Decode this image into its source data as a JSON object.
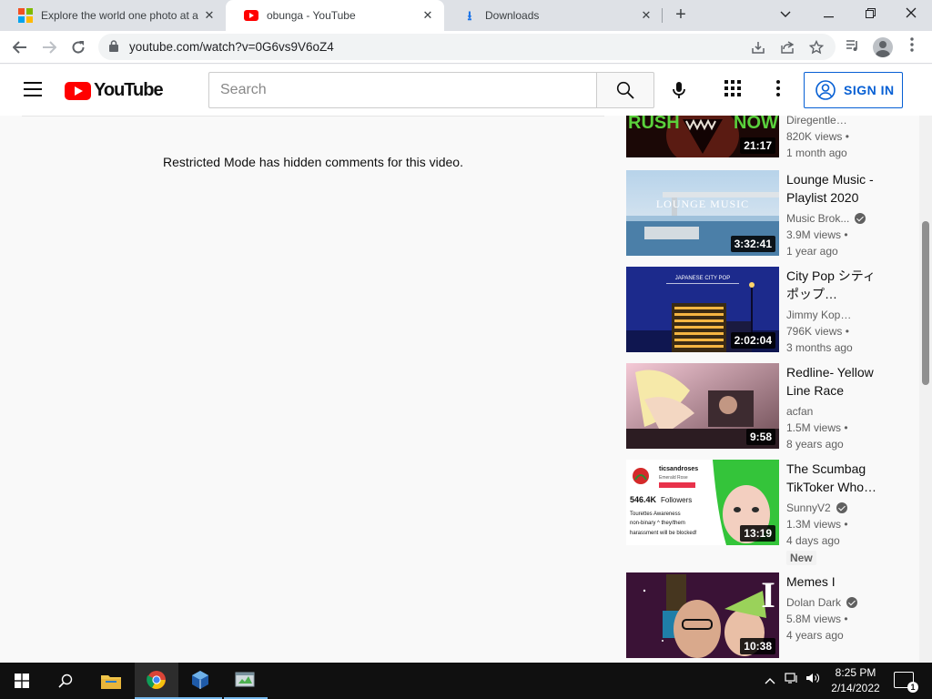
{
  "browser": {
    "tabs": [
      {
        "title": "Explore the world one photo at a",
        "favicon": "microsoft-icon",
        "active": false
      },
      {
        "title": "obunga - YouTube",
        "favicon": "youtube-icon",
        "active": true
      },
      {
        "title": "Downloads",
        "favicon": "download-icon",
        "active": false
      }
    ],
    "new_tab": "+",
    "url": "youtube.com/watch?v=0G6vs9V6oZ4"
  },
  "youtube": {
    "logo_text": "YouTube",
    "search_placeholder": "Search",
    "signin_label": "SIGN IN",
    "restricted_message": "Restricted Mode has hidden comments for this video.",
    "recommendations": [
      {
        "title": "",
        "channel": "Diregentleman",
        "verified": false,
        "views": "820K views •",
        "age": "1 month ago",
        "duration": "21:17",
        "badge": ""
      },
      {
        "title": "Lounge Music - Playlist 2020",
        "channel": "Music Brok...",
        "verified": true,
        "views": "3.9M views •",
        "age": "1 year ago",
        "duration": "3:32:41",
        "badge": ""
      },
      {
        "title": "City Pop シティポップ…",
        "channel": "Jimmy Koproto",
        "verified": false,
        "views": "796K views •",
        "age": "3 months ago",
        "duration": "2:02:04",
        "badge": ""
      },
      {
        "title": "Redline- Yellow Line Race",
        "channel": "acfan",
        "verified": false,
        "views": "1.5M views •",
        "age": "8 years ago",
        "duration": "9:58",
        "badge": ""
      },
      {
        "title": "The Scumbag TikToker Who…",
        "channel": "SunnyV2",
        "verified": true,
        "views": "1.3M views •",
        "age": "4 days ago",
        "duration": "13:19",
        "badge": "New"
      },
      {
        "title": "Memes I",
        "channel": "Dolan Dark",
        "verified": true,
        "views": "5.8M views •",
        "age": "4 years ago",
        "duration": "10:38",
        "badge": ""
      }
    ],
    "thumb_text": {
      "rush_left": "RUSH",
      "rush_right": "NOW",
      "lounge": "LOUNGE MUSIC",
      "city_pop": "JAPANESE CITY POP",
      "tiktok_handle": "ticsandroses",
      "tiktok_sub": "Emerald Rose",
      "tiktok_followers": "546.4K",
      "tiktok_followers_label": "Followers",
      "tiktok_bio1": "Tourettes Awareness",
      "tiktok_bio2": "non-binary ^ they/them",
      "tiktok_bio3": "harassment will be blocked!",
      "memes_letter": "I"
    }
  },
  "taskbar": {
    "time": "8:25 PM",
    "date": "2/14/2022",
    "notification_count": "1"
  }
}
